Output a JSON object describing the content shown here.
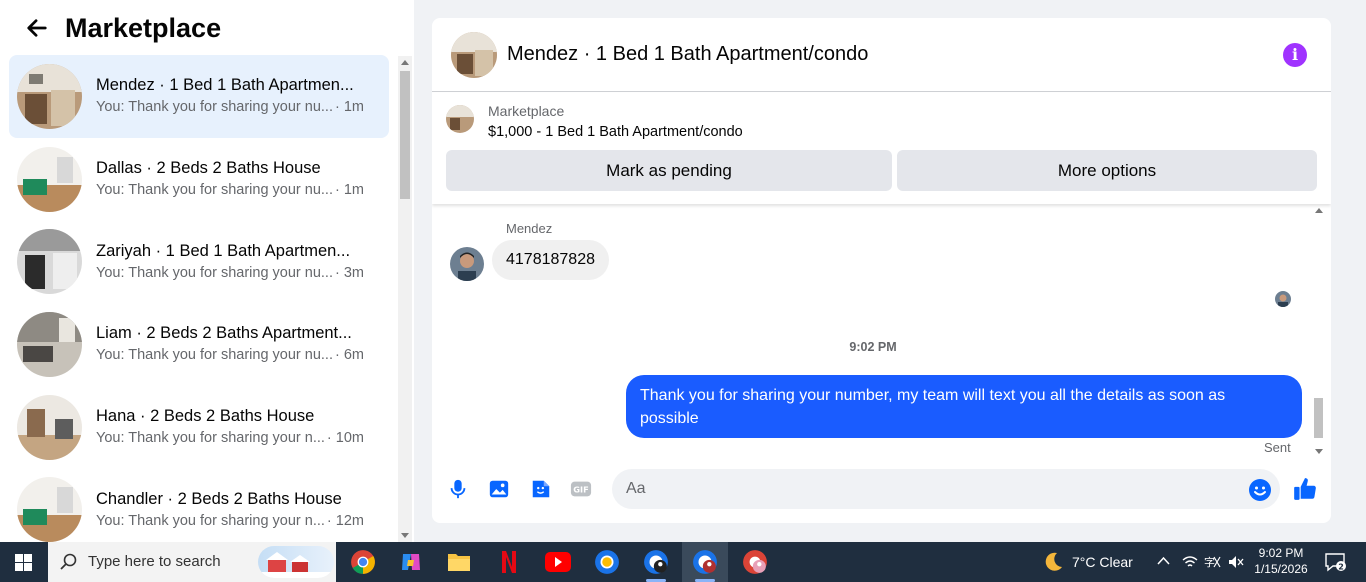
{
  "sidebar": {
    "title": "Marketplace",
    "conversations": [
      {
        "title": "Mendez · 1 Bed 1 Bath Apartmen...",
        "snippet": "You: Thank you for sharing your nu...",
        "time": "· 1m",
        "active": true
      },
      {
        "title": "Dallas · 2 Beds 2 Baths House",
        "snippet": "You: Thank you for sharing your nu...",
        "time": "· 1m"
      },
      {
        "title": "Zariyah · 1 Bed 1 Bath Apartmen...",
        "snippet": "You: Thank you for sharing your nu...",
        "time": "· 3m"
      },
      {
        "title": "Liam · 2 Beds 2 Baths Apartment...",
        "snippet": "You: Thank you for sharing your nu...",
        "time": "· 6m"
      },
      {
        "title": "Hana · 2 Beds 2 Baths House",
        "snippet": "You: Thank you for sharing your n...",
        "time": "· 10m"
      },
      {
        "title": "Chandler · 2 Beds 2 Baths House",
        "snippet": "You: Thank you for sharing your n...",
        "time": "· 12m"
      }
    ]
  },
  "chat": {
    "title": "Mendez · 1 Bed 1 Bath Apartment/condo",
    "listing_source": "Marketplace",
    "listing_price": "$1,000 - 1 Bed 1 Bath Apartment/condo",
    "mark_pending_label": "Mark as pending",
    "more_options_label": "More options",
    "sender_name": "Mendez",
    "incoming_message": "4178187828",
    "timestamp": "9:02 PM",
    "outgoing_message": "Thank you for  sharing your number, my team will text you all the details as soon as possible",
    "status": "Sent",
    "input_placeholder": "Aa"
  },
  "taskbar": {
    "search_placeholder": "Type here to search",
    "weather": "7°C  Clear",
    "time": "9:02 PM",
    "date": "1/15/2026",
    "notification_count": "2"
  },
  "colors": {
    "accent": "#1a5cff",
    "info": "#a033ff",
    "active_item": "#e7f1fd"
  }
}
